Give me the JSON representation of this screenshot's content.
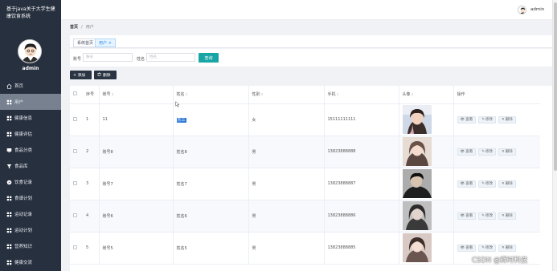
{
  "app": {
    "title": "基于java关于大学生健康饮食系统"
  },
  "user": {
    "name": "admin"
  },
  "sidebar": {
    "items": [
      {
        "label": "首页",
        "icon": "home-icon"
      },
      {
        "label": "用户",
        "icon": "grid-icon"
      },
      {
        "label": "健康信息",
        "icon": "grid-icon"
      },
      {
        "label": "健康评估",
        "icon": "grid-icon"
      },
      {
        "label": "食品分类",
        "icon": "monitor-icon"
      },
      {
        "label": "食品库",
        "icon": "filter-icon"
      },
      {
        "label": "饮食记录",
        "icon": "compass-icon"
      },
      {
        "label": "食谱计划",
        "icon": "grid-icon"
      },
      {
        "label": "运动记录",
        "icon": "grid-icon"
      },
      {
        "label": "运动计划",
        "icon": "grid-icon"
      },
      {
        "label": "营养知识",
        "icon": "grid-icon"
      },
      {
        "label": "健康交流",
        "icon": "grid-icon"
      }
    ],
    "active_index": 1
  },
  "topbar": {
    "username": "admin"
  },
  "breadcrumb": {
    "home": "首页",
    "separator": "/",
    "current": "用户"
  },
  "tabs": [
    {
      "label": "系统首页"
    },
    {
      "label": "用户 ×",
      "active": true
    }
  ],
  "search": {
    "account_label": "账号",
    "account_placeholder": "账号",
    "name_label": "姓名",
    "name_placeholder": "姓名",
    "query_button": "查询"
  },
  "actions": {
    "add": "+ 添加",
    "delete": "删除"
  },
  "table": {
    "headers": [
      "序号",
      "账号",
      "姓名",
      "性别",
      "手机",
      "头像",
      "操作"
    ],
    "op_labels": {
      "view": "查看",
      "edit": "修改",
      "delete": "删除"
    },
    "rows": [
      {
        "index": "1",
        "account": "11",
        "name": "乐三",
        "gender": "女",
        "phone": "15111111111"
      },
      {
        "index": "2",
        "account": "账号8",
        "name": "姓名8",
        "gender": "男",
        "phone": "13823888888"
      },
      {
        "index": "3",
        "account": "账号7",
        "name": "姓名7",
        "gender": "男",
        "phone": "13823888887"
      },
      {
        "index": "4",
        "account": "账号6",
        "name": "姓名6",
        "gender": "男",
        "phone": "13823888886"
      },
      {
        "index": "5",
        "account": "账号5",
        "name": "姓名5",
        "gender": "男",
        "phone": "13823888885"
      }
    ]
  },
  "watermark": "CSDN @辉时科技",
  "colors": {
    "sidebar_bg": "#27303f",
    "sidebar_active": "#778190",
    "query_button": "#19a5a5",
    "action_button": "#2b3442",
    "selection_highlight": "#2f7ad6"
  }
}
